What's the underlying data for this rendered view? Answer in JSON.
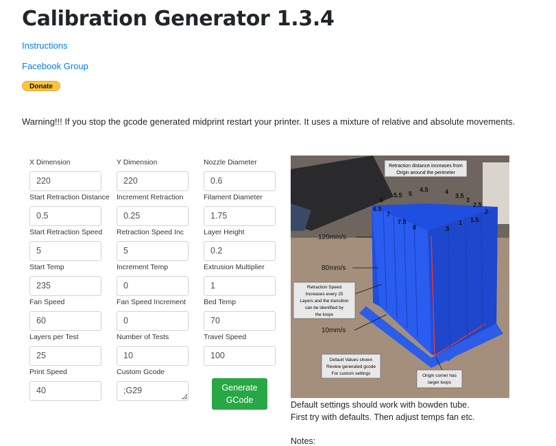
{
  "page": {
    "title": "Calibration Generator 1.3.4",
    "links": [
      "Instructions",
      "Facebook Group"
    ],
    "donate_label": "Donate",
    "warning": "Warning!!! If you stop the gcode generated midprint restart your printer. It uses a mixture of relative and absolute movements."
  },
  "form": {
    "fields": [
      {
        "label": "X Dimension",
        "value": "220"
      },
      {
        "label": "Y Dimension",
        "value": "220"
      },
      {
        "label": "Nozzle Diameter",
        "value": "0.6"
      },
      {
        "label": "Start Retraction Distance",
        "value": "0.5"
      },
      {
        "label": "Increment Retraction",
        "value": "0.25"
      },
      {
        "label": "Filament Diameter",
        "value": "1.75"
      },
      {
        "label": "Start Retraction Speed",
        "value": "5"
      },
      {
        "label": "Retraction Speed Inc",
        "value": "5"
      },
      {
        "label": "Layer Height",
        "value": "0.2"
      },
      {
        "label": "Start Temp",
        "value": "235"
      },
      {
        "label": "Increment Temp",
        "value": "0"
      },
      {
        "label": "Extrusion Multiplier",
        "value": "1"
      },
      {
        "label": "Fan Speed",
        "value": "60"
      },
      {
        "label": "Fan Speed Increment",
        "value": "0"
      },
      {
        "label": "Bed Temp",
        "value": "70"
      },
      {
        "label": "Layers per Test",
        "value": "25"
      },
      {
        "label": "Number of Tests",
        "value": "10"
      },
      {
        "label": "Travel Speed",
        "value": "100"
      },
      {
        "label": "Print Speed",
        "value": "40"
      },
      {
        "label": "Custom Gcode",
        "value": ";G29",
        "multiline": true
      }
    ],
    "generate_label_1": "Generate",
    "generate_label_2": "GCode",
    "button_color": "#28a745"
  },
  "photo": {
    "callout_top_1": "Retraction distance increases from",
    "callout_top_2": "Origin around the perimeter",
    "distance_labels": [
      "6",
      "5.5",
      "5",
      "4.5",
      "4",
      "3.5",
      "3",
      "2.5",
      "2",
      "6.5",
      "7",
      "7.5",
      "8",
      ".5",
      "1",
      "1.5"
    ],
    "speed_labels": [
      "120mm/s",
      "80mm/s",
      "10mm/s"
    ],
    "callout_speed": [
      "Retraction Speed",
      "Increases every 25",
      "Layers and the transition",
      "can be identified by",
      "the loops"
    ],
    "callout_default": [
      "Default Values shown",
      "Review generated gcode",
      "For custom settings"
    ],
    "callout_origin": [
      "Origin corner has",
      "larger loops"
    ]
  },
  "notes": {
    "line1": "Default settings should work with bowden tube.",
    "line2": "First try with defaults. Then adjust temps fan etc.",
    "heading": "Notes:"
  }
}
